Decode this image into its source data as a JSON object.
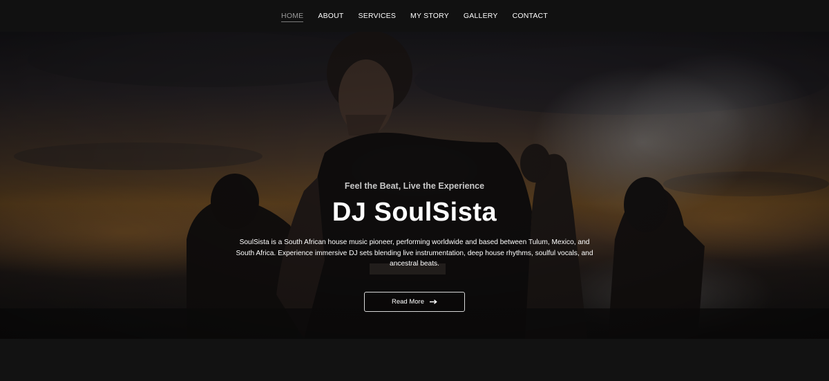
{
  "nav": {
    "items": [
      {
        "label": "HOME",
        "active": true
      },
      {
        "label": "ABOUT",
        "active": false
      },
      {
        "label": "SERVICES",
        "active": false
      },
      {
        "label": "MY STORY",
        "active": false
      },
      {
        "label": "GALLERY",
        "active": false
      },
      {
        "label": "CONTACT",
        "active": false
      }
    ]
  },
  "hero": {
    "tagline": "Feel the Beat, Live the Experience",
    "title": "DJ SoulSista",
    "description": "SoulSista is a South African house music pioneer, performing worldwide and based between Tulum, Mexico, and South Africa. Experience immersive DJ sets blending live instrumentation, deep house rhythms, soulful vocals, and ancestral beats.",
    "cta_label": "Read More",
    "cta_icon": "arrow-right-icon"
  },
  "colors": {
    "nav_background": "#111111",
    "page_background": "#121212",
    "sunset_accent": "#5a3e1d"
  }
}
